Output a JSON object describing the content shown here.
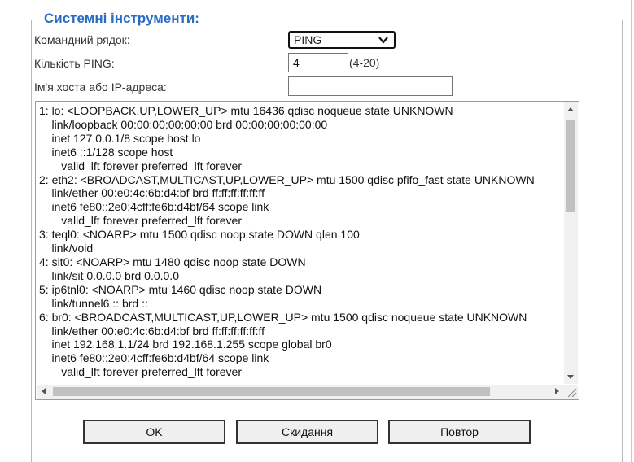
{
  "section": {
    "title": "Системні інструменти:"
  },
  "form": {
    "command_label": "Командний рядок:",
    "command_value": "PING",
    "count_label": "Кількість PING:",
    "count_value": "4",
    "count_range": "(4-20)",
    "host_label": "Ім'я хоста або IP-адреса:",
    "host_value": ""
  },
  "output": {
    "lines": [
      "1: lo: <LOOPBACK,UP,LOWER_UP> mtu 16436 qdisc noqueue state UNKNOWN",
      "    link/loopback 00:00:00:00:00:00 brd 00:00:00:00:00:00",
      "    inet 127.0.0.1/8 scope host lo",
      "    inet6 ::1/128 scope host",
      "       valid_lft forever preferred_lft forever",
      "2: eth2: <BROADCAST,MULTICAST,UP,LOWER_UP> mtu 1500 qdisc pfifo_fast state UNKNOWN",
      "    link/ether 00:e0:4c:6b:d4:bf brd ff:ff:ff:ff:ff:ff",
      "    inet6 fe80::2e0:4cff:fe6b:d4bf/64 scope link",
      "       valid_lft forever preferred_lft forever",
      "3: teql0: <NOARP> mtu 1500 qdisc noop state DOWN qlen 100",
      "    link/void",
      "4: sit0: <NOARP> mtu 1480 qdisc noop state DOWN",
      "    link/sit 0.0.0.0 brd 0.0.0.0",
      "5: ip6tnl0: <NOARP> mtu 1460 qdisc noop state DOWN",
      "    link/tunnel6 :: brd ::",
      "6: br0: <BROADCAST,MULTICAST,UP,LOWER_UP> mtu 1500 qdisc noqueue state UNKNOWN",
      "    link/ether 00:e0:4c:6b:d4:bf brd ff:ff:ff:ff:ff:ff",
      "    inet 192.168.1.1/24 brd 192.168.1.255 scope global br0",
      "    inet6 fe80::2e0:4cff:fe6b:d4bf/64 scope link",
      "       valid_lft forever preferred_lft forever"
    ]
  },
  "buttons": {
    "ok": "OK",
    "reset": "Скидання",
    "repeat": "Повтор"
  },
  "icons": {
    "select_arrow": "chevron-down-icon",
    "scroll_up": "scroll-up-arrow-icon",
    "scroll_down": "scroll-down-arrow-icon",
    "scroll_left": "scroll-left-arrow-icon",
    "scroll_right": "scroll-right-arrow-icon",
    "resize": "resize-grip-icon"
  }
}
